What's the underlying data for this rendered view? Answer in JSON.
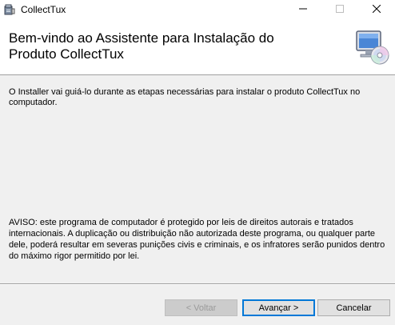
{
  "window": {
    "title": "CollectTux",
    "icons": {
      "app": "installer-box-icon",
      "minimize": "minimize-icon",
      "maximize": "maximize-icon",
      "close": "close-icon"
    }
  },
  "banner": {
    "title": "Bem-vindo ao Assistente para Instalação do Produto CollectTux",
    "icon": "computer-cd-icon"
  },
  "content": {
    "intro": "O Installer vai guiá-lo durante as etapas necessárias para instalar o produto CollectTux no computador.",
    "warning": "AVISO: este programa de computador é protegido por leis de direitos autorais e tratados internacionais. A duplicação ou distribuição não autorizada deste programa, ou qualquer parte dele, poderá resultar em severas punições civis e criminais, e os infratores serão punidos dentro do máximo rigor permitido por lei."
  },
  "buttons": {
    "back": "< Voltar",
    "next": "Avançar >",
    "cancel": "Cancelar"
  },
  "colors": {
    "accent": "#0078d7",
    "background": "#f0f0f0",
    "banner": "#ffffff"
  }
}
